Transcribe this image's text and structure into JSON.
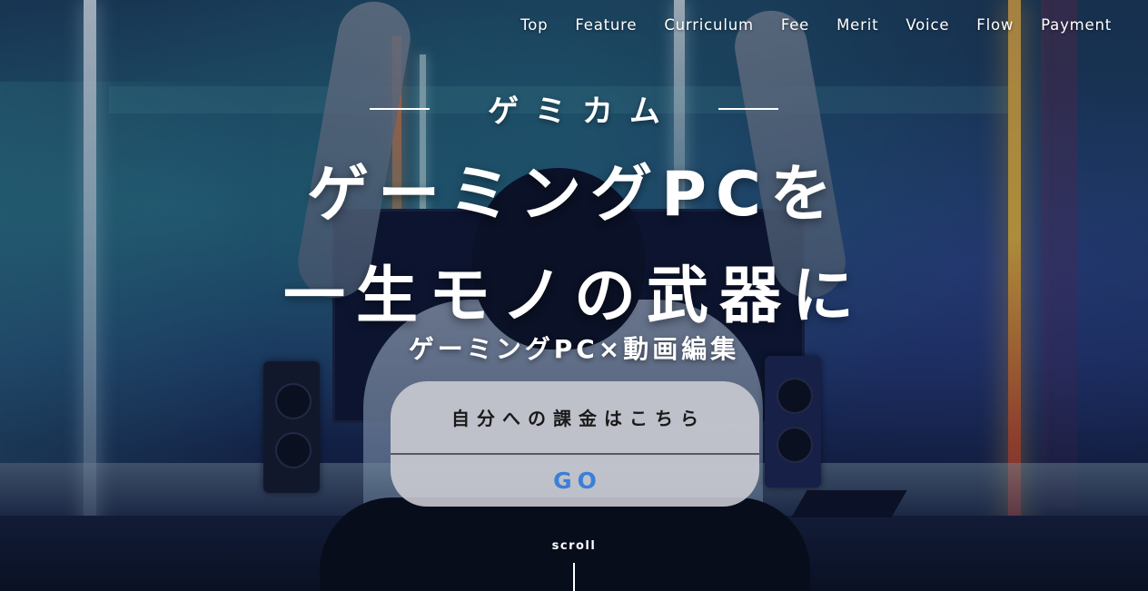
{
  "nav": {
    "items": [
      {
        "label": "Top"
      },
      {
        "label": "Feature"
      },
      {
        "label": "Curriculum"
      },
      {
        "label": "Fee"
      },
      {
        "label": "Merit"
      },
      {
        "label": "Voice"
      },
      {
        "label": "Flow"
      },
      {
        "label": "Payment"
      }
    ]
  },
  "hero": {
    "brand": "ゲミカム",
    "headline_line1": "ゲーミングPCを",
    "headline_line2": "一生モノの武器に",
    "subheadline": "ゲーミングPC×動画編集",
    "cta": {
      "label": "自分への課金はこちら",
      "go_label": "GO",
      "go_color": "#3b7fd8"
    },
    "scroll_label": "scroll"
  }
}
